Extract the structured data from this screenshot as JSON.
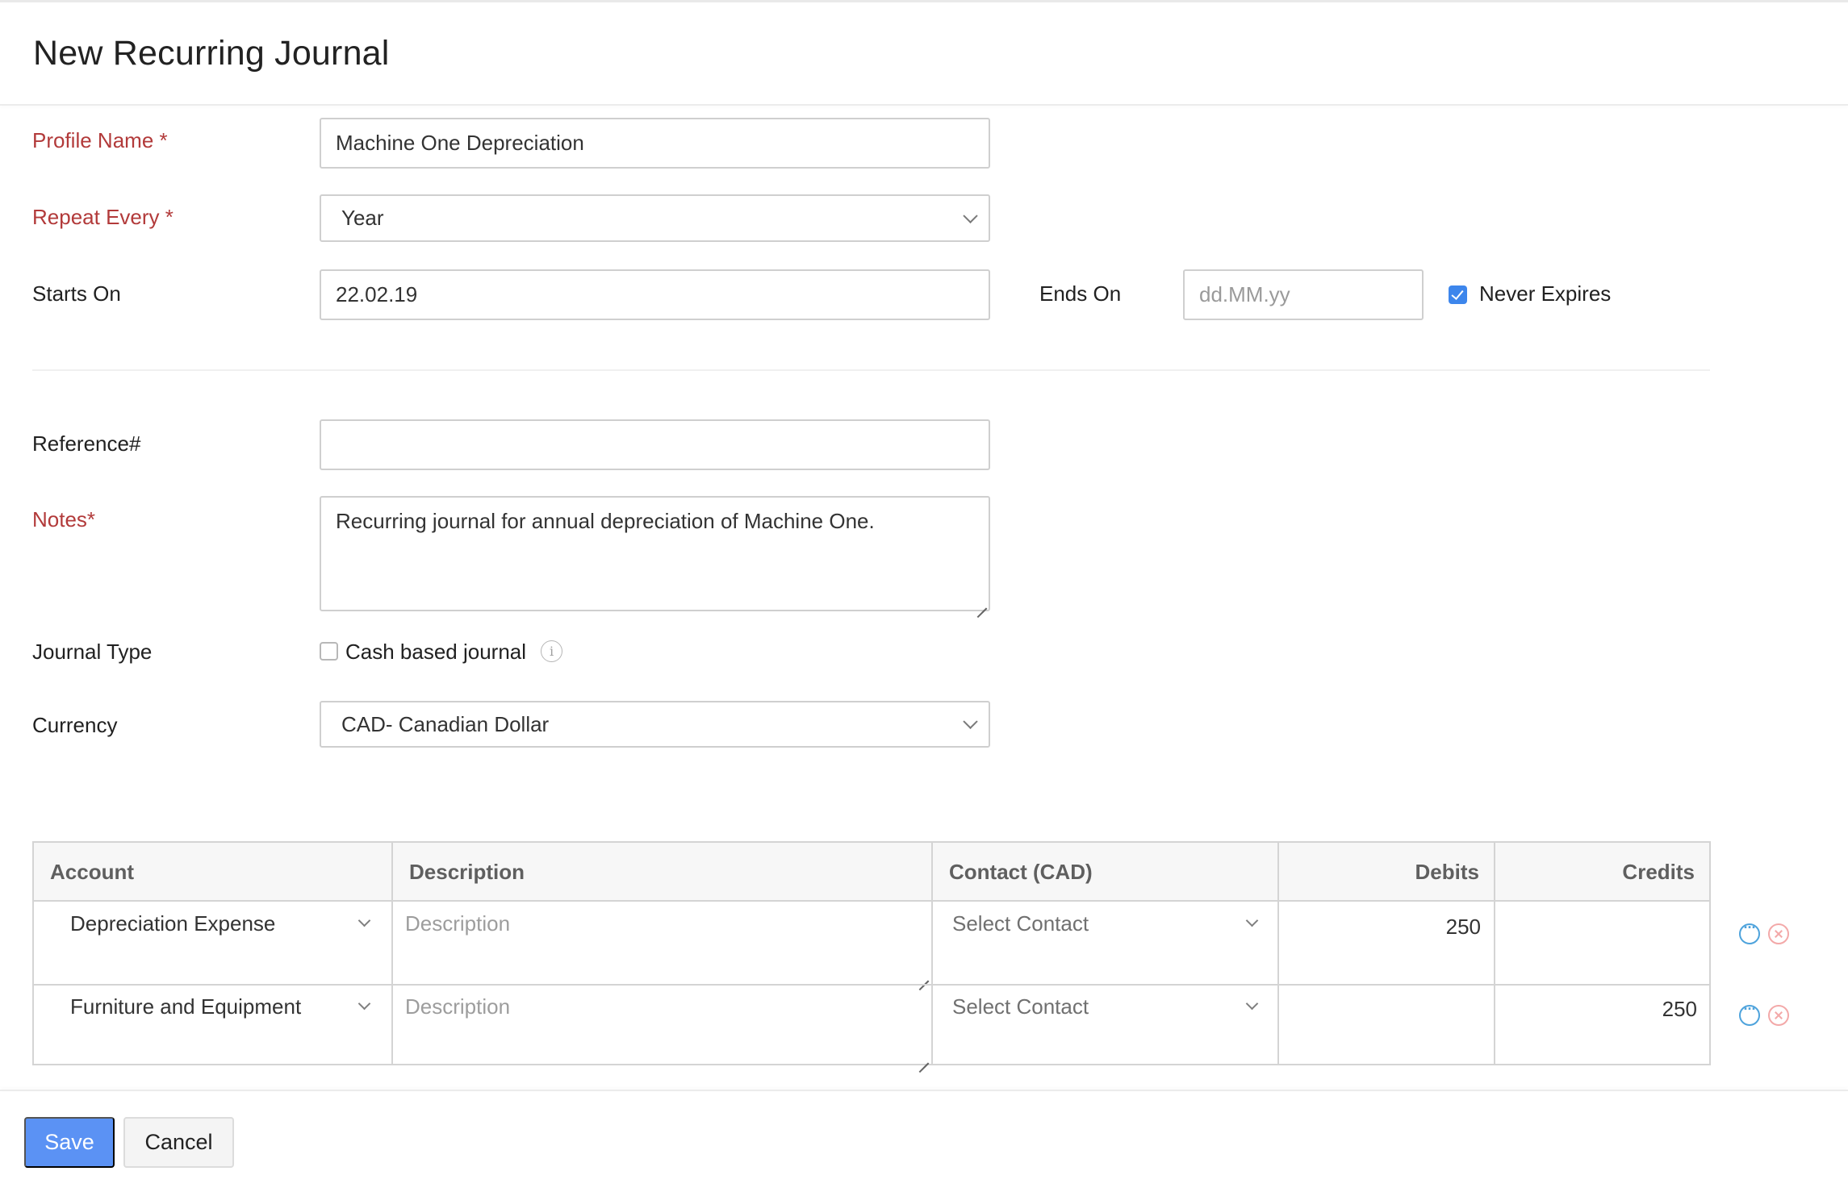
{
  "page": {
    "title": "New Recurring Journal"
  },
  "form": {
    "profile_name": {
      "label": "Profile Name *",
      "value": "Machine One Depreciation"
    },
    "repeat_every": {
      "label": "Repeat Every *",
      "value": "Year"
    },
    "starts_on": {
      "label": "Starts On",
      "value": "22.02.19"
    },
    "ends_on": {
      "label": "Ends On",
      "value": "",
      "placeholder": "dd.MM.yy"
    },
    "never_expires": {
      "label": "Never Expires",
      "checked": true
    },
    "reference": {
      "label": "Reference#",
      "value": ""
    },
    "notes": {
      "label": "Notes*",
      "value": "Recurring journal for annual depreciation of Machine One."
    },
    "journal_type": {
      "label": "Journal Type",
      "option_label": "Cash based journal",
      "checked": false
    },
    "currency": {
      "label": "Currency",
      "value": "CAD- Canadian Dollar"
    }
  },
  "table": {
    "columns": [
      "Account",
      "Description",
      "Contact (CAD)",
      "Debits",
      "Credits"
    ],
    "rows": [
      {
        "account": "Depreciation Expense",
        "description": "",
        "description_placeholder": "Description",
        "contact": "Select Contact",
        "debit": "250",
        "credit": ""
      },
      {
        "account": "Furniture and Equipment",
        "description": "",
        "description_placeholder": "Description",
        "contact": "Select Contact",
        "debit": "",
        "credit": "250"
      }
    ]
  },
  "footer": {
    "save_label": "Save",
    "cancel_label": "Cancel"
  },
  "colors": {
    "required_label": "#b23a3a",
    "primary_button": "#5b92f4",
    "checkbox_checked": "#3d86ec",
    "more_icon": "#4ea3dc",
    "remove_icon": "#f3a9a9"
  }
}
